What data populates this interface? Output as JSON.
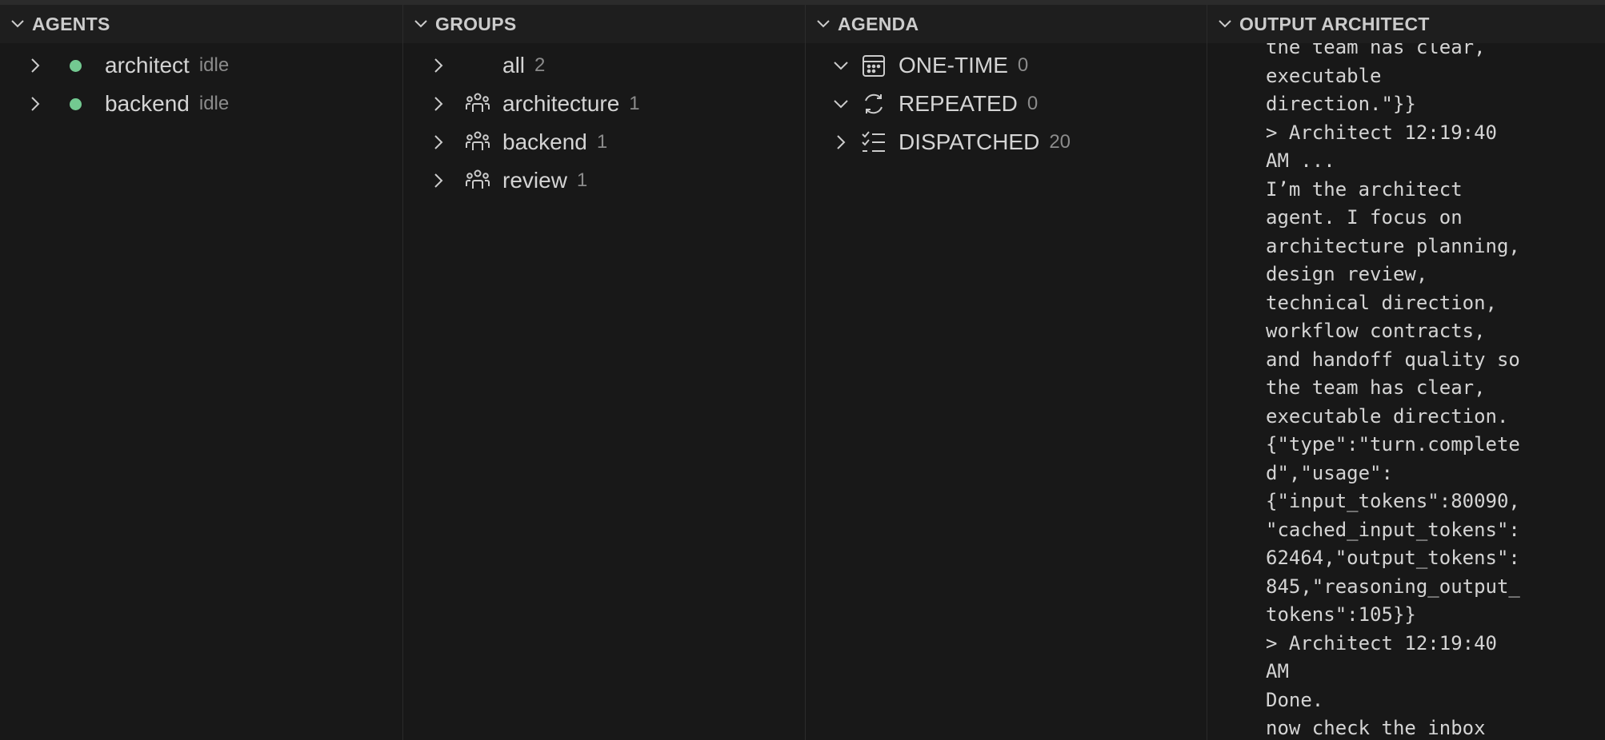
{
  "colors": {
    "background": "#181818",
    "header_background": "#1e1e1e",
    "status_idle": "#73c991",
    "text": "#d4d4d4",
    "muted": "#8b8b8b"
  },
  "agents": {
    "title": "AGENTS",
    "items": [
      {
        "name": "architect",
        "status": "idle"
      },
      {
        "name": "backend",
        "status": "idle"
      }
    ]
  },
  "groups": {
    "title": "GROUPS",
    "items": [
      {
        "name": "all",
        "count": "2",
        "icon": "none"
      },
      {
        "name": "architecture",
        "count": "1",
        "icon": "people-group-icon"
      },
      {
        "name": "backend",
        "count": "1",
        "icon": "people-group-icon"
      },
      {
        "name": "review",
        "count": "1",
        "icon": "people-group-icon"
      }
    ]
  },
  "agenda": {
    "title": "AGENDA",
    "items": [
      {
        "name": "ONE-TIME",
        "count": "0",
        "icon": "calendar-icon",
        "expanded": true
      },
      {
        "name": "REPEATED",
        "count": "0",
        "icon": "sync-icon",
        "expanded": true
      },
      {
        "name": "DISPATCHED",
        "count": "20",
        "icon": "checklist-icon",
        "expanded": false
      }
    ]
  },
  "output": {
    "title": "OUTPUT ARCHITECT",
    "lines": [
      "the team has clear,",
      "executable",
      "direction.\"}}",
      "> Architect 12:19:40",
      "AM ...",
      "I’m the architect",
      "agent. I focus on",
      "architecture planning,",
      "design review,",
      "technical direction,",
      "workflow contracts,",
      "and handoff quality so",
      "the team has clear,",
      "executable direction.",
      "{\"type\":\"turn.complete",
      "d\",\"usage\":",
      "{\"input_tokens\":80090,",
      "\"cached_input_tokens\":",
      "62464,\"output_tokens\":",
      "845,\"reasoning_output_",
      "tokens\":105}}",
      "> Architect 12:19:40",
      "AM",
      "Done.",
      "now check the inbox"
    ]
  }
}
